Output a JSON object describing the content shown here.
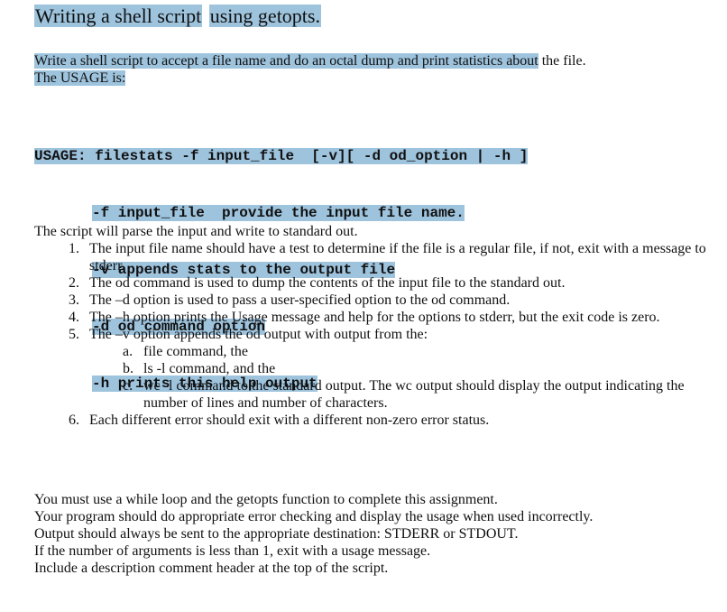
{
  "title": {
    "part1": "Writing a shell script",
    "part2": "using getopts."
  },
  "intro": {
    "line1_part1": "Write a shell script to accept a file name and do an octal dump and print statistics about",
    "line1_part2": "the file.",
    "line2": "The USAGE is:"
  },
  "usage": {
    "lines": [
      "USAGE: filestats -f input_file  [-v][ -d od_option | -h ]",
      "-f input_file  provide the input file name.",
      "-v appends stats to the output file",
      "-d od command option",
      "-h prints this help output"
    ]
  },
  "body": {
    "intro": "The script will parse the input and write to standard out.",
    "items": [
      {
        "num": "1.",
        "text": "The input file name should have a test to determine if the file is a regular file, if not, exit with a message to stderr."
      },
      {
        "num": "2.",
        "text": "The od command is used to dump the contents of the input file to the standard out."
      },
      {
        "num": "3.",
        "text": "The –d option is used to pass a user-specified option to the od command."
      },
      {
        "num": "4.",
        "text": "The –h option prints the Usage message and help for the options to stderr, but the exit code is zero."
      },
      {
        "num": "5.",
        "text": "The –v option appends the od output with output from the:",
        "subitems": [
          {
            "letter": "a.",
            "text": "file command, the"
          },
          {
            "letter": "b.",
            "text": "ls -l command, and the"
          },
          {
            "letter": "c.",
            "text": "wc -l command to the standard output. The wc output should display the output indicating the number of lines and number of characters."
          }
        ]
      },
      {
        "num": "6.",
        "text": "Each different error should exit with a different non-zero error status."
      }
    ]
  },
  "closing": [
    "You must use a while loop and the getopts function to complete this assignment.",
    "Your program should do appropriate error checking and display the usage when used incorrectly.",
    "Output should always be sent to the appropriate destination: STDERR or STDOUT.",
    "If the number of arguments is less than 1, exit with a usage message.",
    "Include a description comment header at the top of the script."
  ],
  "colors": {
    "selection_highlight": "#9ec3dd",
    "text": "#111111",
    "background": "#ffffff"
  }
}
